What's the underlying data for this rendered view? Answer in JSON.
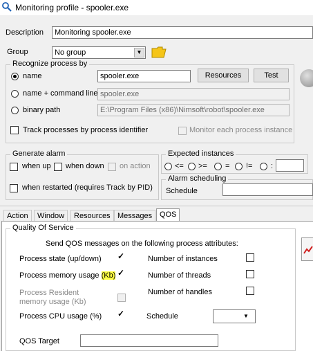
{
  "window": {
    "title": "Monitoring profile - spooler.exe"
  },
  "description": {
    "label": "Description",
    "value": "Monitoring spooler.exe"
  },
  "group": {
    "label": "Group",
    "value": "No group"
  },
  "recognize": {
    "legend": "Recognize process by",
    "name_label": "name",
    "name_value": "spooler.exe",
    "resources_button": "Resources",
    "test_button": "Test",
    "cmdline_label": "name + command line",
    "cmdline_value": "spooler.exe",
    "binary_label": "binary path",
    "binary_value": "E:\\Program Files (x86)\\Nimsoft\\robot\\spooler.exe",
    "track_pid_label": "Track processes by process identifier",
    "monitor_each_label": "Monitor each process instance"
  },
  "generate_alarm": {
    "legend": "Generate alarm",
    "when_up": "when up",
    "when_down": "when down",
    "on_action": "on action",
    "when_restarted": "when restarted (requires Track by PID)"
  },
  "expected_instances": {
    "legend": "Expected instances",
    "ops": [
      "<=",
      ">=",
      "=",
      "!=",
      ":"
    ]
  },
  "alarm_scheduling": {
    "legend": "Alarm scheduling",
    "schedule_label": "Schedule"
  },
  "tabs": [
    "Action",
    "Window",
    "Resources",
    "Messages",
    "QOS"
  ],
  "qos": {
    "legend": "Quality Of Service",
    "intro": "Send QOS messages on the following process attributes:",
    "process_state": "Process state (up/down)",
    "memory_usage_prefix": "Process memory usage ",
    "memory_usage_hl": "(Kb)",
    "resident_memory": "Process Resident memory usage (Kb)",
    "cpu_usage": "Process CPU usage (%)",
    "num_instances": "Number of instances",
    "num_threads": "Number of threads",
    "num_handles": "Number of handles",
    "schedule_label": "Schedule",
    "qos_target_label": "QOS Target"
  }
}
